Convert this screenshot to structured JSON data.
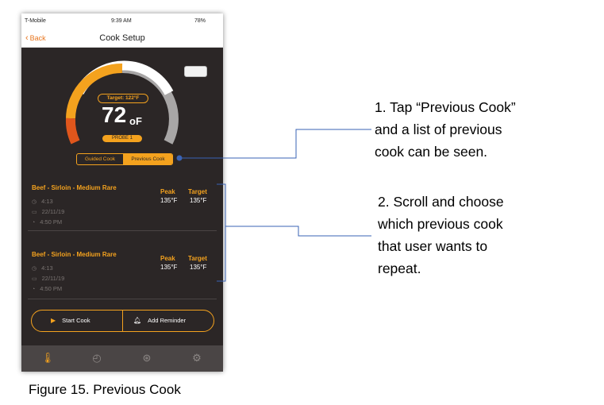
{
  "status_bar": {
    "carrier": "T-Mobile",
    "time": "9:39 AM",
    "battery": "78%"
  },
  "nav": {
    "back_label": "Back",
    "title": "Cook Setup"
  },
  "gauge": {
    "target_label": "Target: 122°F",
    "temperature": "72",
    "unit": "oF",
    "probe_label": "PROBE 1"
  },
  "mode_toggle": {
    "option_1": "Guided Cook",
    "option_2": "Previous Cook",
    "selected": "Previous Cook"
  },
  "previous_cooks": [
    {
      "name": "Beef - Sirloin - Medium Rare",
      "duration": "4:13",
      "date": "22/11/19",
      "time": "4:50 PM",
      "peak_label": "Peak",
      "target_label": "Target",
      "peak": "135°F",
      "target": "135°F"
    },
    {
      "name": "Beef - Sirloin - Medium Rare",
      "duration": "4:13",
      "date": "22/11/19",
      "time": "4:50 PM",
      "peak_label": "Peak",
      "target_label": "Target",
      "peak": "135°F",
      "target": "135°F"
    }
  ],
  "actions": {
    "start_label": "Start Cook",
    "reminder_label": "Add Reminder"
  },
  "tabs": [
    {
      "icon": "thermometer-icon",
      "active": true
    },
    {
      "icon": "clock-icon",
      "active": false
    },
    {
      "icon": "aperture-icon",
      "active": false
    },
    {
      "icon": "gear-icon",
      "active": false
    }
  ],
  "annotations": {
    "callout_1": [
      "1. Tap “Previous Cook”",
      "and a list of previous",
      "cook can be seen."
    ],
    "callout_2": [
      "2. Scroll and choose",
      "which previous cook",
      "that user wants to",
      "repeat."
    ]
  },
  "caption": "Figure 15. Previous Cook",
  "colors": {
    "accent": "#f4a21e",
    "background": "#2b2626",
    "gauge_red": "#e0561c",
    "gauge_grey": "#a8a6a6",
    "line": "#3a63b4"
  }
}
